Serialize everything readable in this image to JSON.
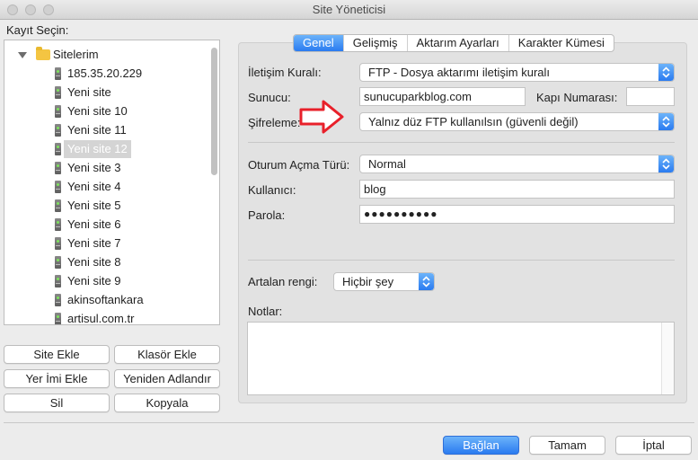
{
  "window": {
    "title": "Site Yöneticisi"
  },
  "left": {
    "label": "Kayıt Seçin:",
    "tree": {
      "root": "Sitelerim",
      "items": [
        "185.35.20.229",
        "Yeni site",
        "Yeni site 10",
        "Yeni site 11",
        "Yeni site 12",
        "Yeni site 3",
        "Yeni site 4",
        "Yeni site 5",
        "Yeni site 6",
        "Yeni site 7",
        "Yeni site 8",
        "Yeni site 9",
        "akinsoftankara",
        "artisul.com.tr"
      ],
      "selected": "Yeni site 12"
    },
    "buttons": {
      "add_site": "Site Ekle",
      "add_folder": "Klasör Ekle",
      "add_bookmark": "Yer İmi Ekle",
      "rename": "Yeniden Adlandır",
      "delete": "Sil",
      "copy": "Kopyala"
    }
  },
  "tabs": [
    {
      "label": "Genel",
      "active": true
    },
    {
      "label": "Gelişmiş",
      "active": false
    },
    {
      "label": "Aktarım Ayarları",
      "active": false
    },
    {
      "label": "Karakter Kümesi",
      "active": false
    }
  ],
  "general": {
    "protocol_label": "İletişim Kuralı:",
    "protocol_value": "FTP - Dosya aktarımı iletişim kuralı",
    "host_label": "Sunucu:",
    "host_value": "sunucuparkblog.com",
    "port_label": "Kapı Numarası:",
    "port_value": "",
    "encryption_label": "Şifreleme:",
    "encryption_value": "Yalnız düz FTP kullanılsın (güvenli değil)",
    "logon_type_label": "Oturum Açma Türü:",
    "logon_type_value": "Normal",
    "user_label": "Kullanıcı:",
    "user_value": "blog",
    "password_label": "Parola:",
    "password_value": "●●●●●●●●●●",
    "bg_color_label": "Artalan rengi:",
    "bg_color_value": "Hiçbir şey",
    "notes_label": "Notlar:",
    "notes_value": ""
  },
  "footer": {
    "connect": "Bağlan",
    "ok": "Tamam",
    "cancel": "İptal"
  },
  "colors": {
    "accent": "#2a7bf0",
    "annotation_arrow": "#e8202a",
    "folder": "#f4c542"
  },
  "icons": {
    "tree_root": "folder-icon",
    "tree_items": "server-icon",
    "annotation": "right-arrow-icon"
  }
}
